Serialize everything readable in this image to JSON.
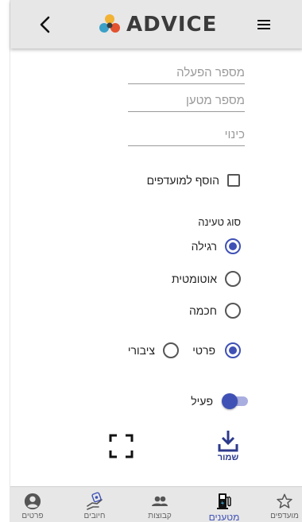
{
  "header": {
    "logo_text": "ADVICE",
    "back_icon": "chevron-left-icon",
    "menu_icon": "hamburger-menu-icon"
  },
  "form": {
    "operation_number_placeholder": "מספר הפעלה",
    "charger_number_placeholder": "מספר מטען",
    "nickname_placeholder": "כינוי",
    "add_to_favorites_label": "הוסף למועדפים",
    "charge_type_label": "סוג טעינה",
    "charge_types": [
      {
        "label": "רגילה",
        "selected": true
      },
      {
        "label": "אוטומטית",
        "selected": false
      },
      {
        "label": "חכמה",
        "selected": false
      }
    ],
    "ownership": [
      {
        "label": "פרטי",
        "selected": true
      },
      {
        "label": "ציבורי",
        "selected": false
      }
    ],
    "active_label": "פעיל",
    "active_on": true,
    "save_label": "שמור"
  },
  "bottom_nav": [
    {
      "label": "פרטים",
      "icon": "account-circle-icon"
    },
    {
      "label": "חיובים",
      "icon": "billing-hand-icon"
    },
    {
      "label": "קבוצות",
      "icon": "group-icon"
    },
    {
      "label": "מטענים",
      "icon": "ev-charger-icon",
      "active": true
    },
    {
      "label": "מועדפים",
      "icon": "star-outline-icon"
    }
  ],
  "colors": {
    "accent": "#3f51b5",
    "header_bg": "#e7e7e7"
  }
}
